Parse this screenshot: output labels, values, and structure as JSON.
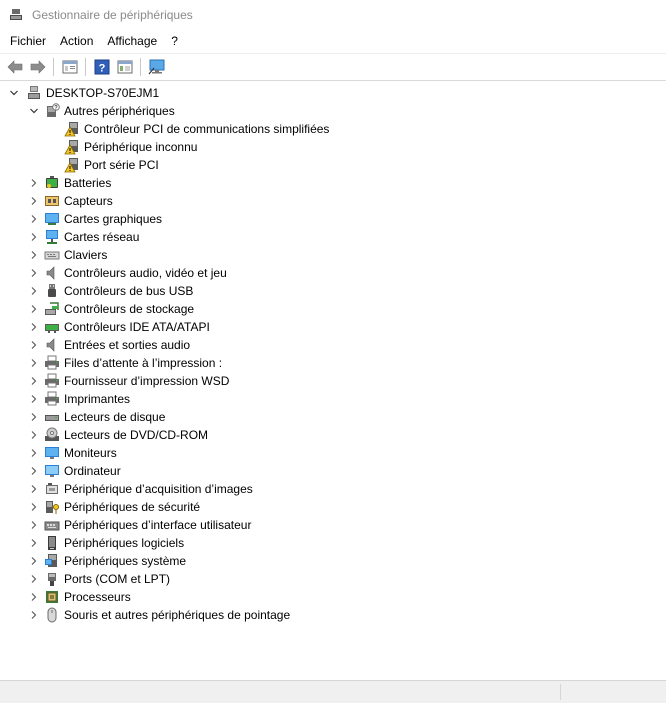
{
  "window": {
    "title": "Gestionnaire de périphériques"
  },
  "menu": [
    {
      "label": "Fichier"
    },
    {
      "label": "Action"
    },
    {
      "label": "Affichage"
    },
    {
      "label": "?"
    }
  ],
  "toolbar": {
    "buttons": [
      "back-arrow-icon",
      "forward-arrow-icon",
      "properties-icon",
      "help-icon",
      "console-tree-icon",
      "monitor-scan-icon"
    ]
  },
  "tree": {
    "root": {
      "label": "DESKTOP-S70EJM1"
    },
    "expanded_category": {
      "label": "Autres périphériques",
      "children": [
        {
          "label": "Contrôleur PCI de communications simplifiées"
        },
        {
          "label": "Périphérique inconnu"
        },
        {
          "label": "Port série PCI"
        }
      ]
    },
    "categories": [
      {
        "label": "Batteries",
        "icon": "battery-icon"
      },
      {
        "label": "Capteurs",
        "icon": "sensor-icon"
      },
      {
        "label": "Cartes graphiques",
        "icon": "display-adapter-icon"
      },
      {
        "label": "Cartes réseau",
        "icon": "network-adapter-icon"
      },
      {
        "label": "Claviers",
        "icon": "keyboard-icon"
      },
      {
        "label": "Contrôleurs audio, vidéo et jeu",
        "icon": "speaker-icon"
      },
      {
        "label": "Contrôleurs de bus USB",
        "icon": "usb-icon"
      },
      {
        "label": "Contrôleurs de stockage",
        "icon": "storage-controller-icon"
      },
      {
        "label": "Contrôleurs IDE ATA/ATAPI",
        "icon": "ide-controller-icon"
      },
      {
        "label": "Entrées et sorties audio",
        "icon": "speaker-icon"
      },
      {
        "label": "Files d’attente à l’impression :",
        "icon": "printer-icon"
      },
      {
        "label": "Fournisseur d’impression WSD",
        "icon": "printer-icon"
      },
      {
        "label": "Imprimantes",
        "icon": "printer-icon"
      },
      {
        "label": "Lecteurs de disque",
        "icon": "disk-drive-icon"
      },
      {
        "label": "Lecteurs de DVD/CD-ROM",
        "icon": "dvd-drive-icon"
      },
      {
        "label": "Moniteurs",
        "icon": "monitor-icon"
      },
      {
        "label": "Ordinateur",
        "icon": "computer-icon"
      },
      {
        "label": "Périphérique d’acquisition d’images",
        "icon": "camera-icon"
      },
      {
        "label": "Périphériques de sécurité",
        "icon": "security-key-icon"
      },
      {
        "label": "Périphériques d’interface utilisateur",
        "icon": "hid-icon"
      },
      {
        "label": "Périphériques logiciels",
        "icon": "software-device-icon"
      },
      {
        "label": "Périphériques système",
        "icon": "system-device-icon"
      },
      {
        "label": "Ports (COM et LPT)",
        "icon": "port-icon"
      },
      {
        "label": "Processeurs",
        "icon": "processor-icon"
      },
      {
        "label": "Souris et autres périphériques de pointage",
        "icon": "mouse-icon"
      }
    ]
  },
  "colors": {
    "accent_blue": "#2c7fd8",
    "warning_yellow": "#f3c623",
    "title_gray": "#8a8a8a"
  }
}
